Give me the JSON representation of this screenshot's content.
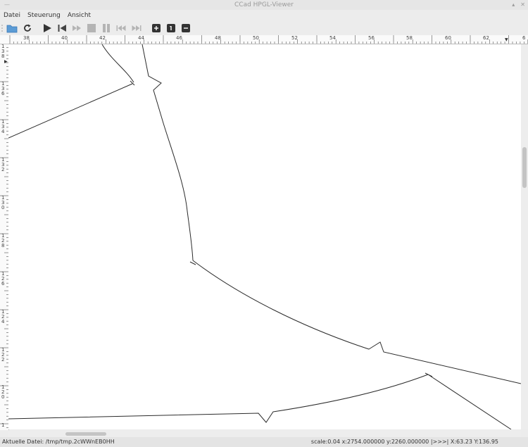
{
  "window": {
    "title": "CCad HPGL-Viewer"
  },
  "menu": {
    "items": [
      "Datei",
      "Steuerung",
      "Ansicht"
    ]
  },
  "ruler": {
    "h_labels": [
      "38",
      "40",
      "42",
      "44",
      "46",
      "48",
      "50",
      "52",
      "54",
      "56",
      "58",
      "60",
      "62",
      "6"
    ],
    "v_labels": [
      "1",
      "3",
      "8",
      "1",
      "3",
      "6",
      "1",
      "3",
      "4",
      "1",
      "3",
      "2",
      "1",
      "3",
      "0",
      "1",
      "2",
      "8",
      "1",
      "2",
      "6",
      "1",
      "2",
      "4",
      "1",
      "2",
      "2",
      "1",
      "2",
      "0",
      "1"
    ]
  },
  "status": {
    "file_label": "Aktuelle Datei: /tmp/tmp.2cWWnEB0HH",
    "info": "scale:0.04 x:2754.000000 y:2260.000000 |>>>| X:63.23 Y:136.95"
  },
  "colors": {
    "stroke": "#2b2b2b",
    "canvas": "#ffffff"
  }
}
